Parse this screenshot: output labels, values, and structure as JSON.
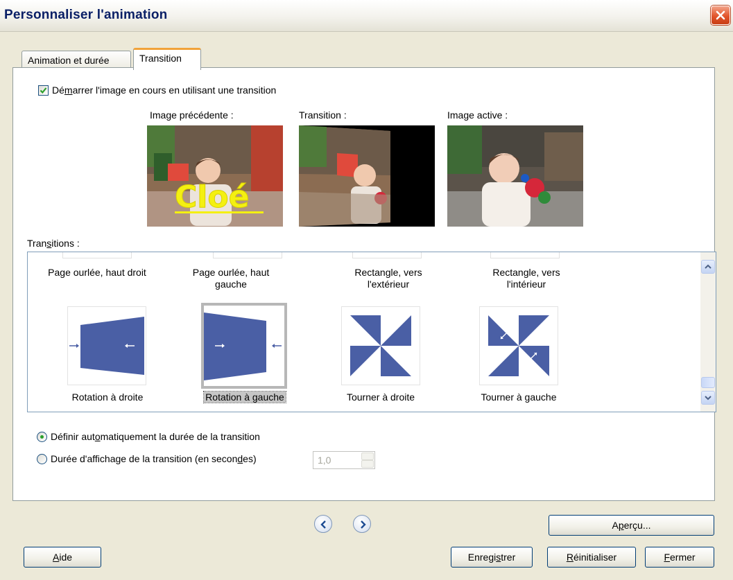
{
  "dialog": {
    "title": "Personnaliser l'animation"
  },
  "tabs": [
    {
      "label": "Animation et durée"
    },
    {
      "label": "Transition"
    }
  ],
  "start_transition": {
    "pre": "Dé",
    "mnemonic": "m",
    "post": "arrer l'image en cours en utilisant une transition",
    "checked": true
  },
  "previews": {
    "previous_label": "Image précédente :",
    "transition_label": "Transition :",
    "active_label": "Image active :",
    "caption_text": "Cloé"
  },
  "transitions": {
    "label_pre": "Tran",
    "label_mnemonic": "s",
    "label_post": "itions :",
    "items_top": [
      {
        "label": "Page ourlée, haut droit"
      },
      {
        "label": "Page ourlée, haut gauche"
      },
      {
        "label": "Rectangle, vers l'extérieur"
      },
      {
        "label": "Rectangle, vers l'intérieur"
      }
    ],
    "items_bottom": [
      {
        "label": "Rotation à droite",
        "icon": "rotate-right-icon"
      },
      {
        "label": "Rotation à gauche",
        "icon": "rotate-left-icon",
        "selected": true
      },
      {
        "label": "Tourner à droite",
        "icon": "turn-right-icon"
      },
      {
        "label": "Tourner à gauche",
        "icon": "turn-left-icon"
      }
    ]
  },
  "duration": {
    "auto_pre": "Définir aut",
    "auto_mnemonic": "o",
    "auto_post": "matiquement la durée de la transition",
    "manual_pre": "Durée d'affichage de la transition (en secon",
    "manual_mnemonic": "d",
    "manual_post": "es)",
    "value": "1,0",
    "selected": "auto"
  },
  "buttons": {
    "preview_pre": "A",
    "preview_mnemonic": "p",
    "preview_post": "erçu...",
    "help_mnemonic": "A",
    "help_post": "ide",
    "save_pre": "Enregi",
    "save_mnemonic": "s",
    "save_post": "trer",
    "reset_mnemonic": "R",
    "reset_post": "éinitialiser",
    "close_mnemonic": "F",
    "close_post": "ermer"
  },
  "colors": {
    "title": "#0a1f66",
    "accent_tab": "#f1a33a",
    "transition_icon": "#4a5fa5",
    "check": "#2ba02b",
    "close_button": "#e2552c"
  }
}
